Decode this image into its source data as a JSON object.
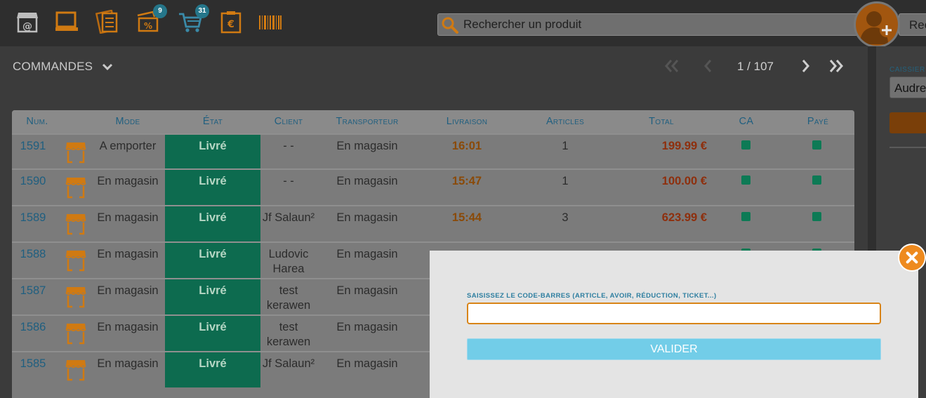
{
  "toolbar": {
    "icons": [
      {
        "name": "shop-email-icon",
        "badge": null
      },
      {
        "name": "laptop-icon",
        "badge": null
      },
      {
        "name": "calculator-icon",
        "badge": null
      },
      {
        "name": "discount-tag-icon",
        "badge": "9"
      },
      {
        "name": "cart-icon",
        "badge": "31"
      },
      {
        "name": "euro-clipboard-icon",
        "badge": null
      },
      {
        "name": "barcode-icon",
        "badge": null
      }
    ],
    "badge_discount": "9",
    "badge_cart": "31",
    "search_placeholder": "Rechercher un produit",
    "search2_text": "Rec"
  },
  "list": {
    "title": "COMMANDES",
    "page_indicator": "1 / 107"
  },
  "table": {
    "headers": {
      "num": "Num.",
      "mode": "Mode",
      "etat": "État",
      "client": "Client",
      "transporteur": "Transporteur",
      "livraison": "Livraison",
      "articles": "Articles",
      "total": "Total",
      "ca": "CA",
      "paye": "Payé"
    },
    "rows": [
      {
        "num": "1591",
        "mode": "A emporter",
        "etat": "Livré",
        "client": "- -",
        "transporteur": "En magasin",
        "livraison": "16:01",
        "articles": "1",
        "total": "199.99 €"
      },
      {
        "num": "1590",
        "mode": "En magasin",
        "etat": "Livré",
        "client": "- -",
        "transporteur": "En magasin",
        "livraison": "15:47",
        "articles": "1",
        "total": "100.00 €"
      },
      {
        "num": "1589",
        "mode": "En magasin",
        "etat": "Livré",
        "client": "Jf Salaun²",
        "transporteur": "En magasin",
        "livraison": "15:44",
        "articles": "3",
        "total": "623.99 €"
      },
      {
        "num": "1588",
        "mode": "En magasin",
        "etat": "Livré",
        "client": "Ludovic Harea",
        "transporteur": "En magasin",
        "livraison": "",
        "articles": "",
        "total": ""
      },
      {
        "num": "1587",
        "mode": "En magasin",
        "etat": "Livré",
        "client": "test kerawen",
        "transporteur": "En magasin",
        "livraison": "",
        "articles": "",
        "total": ""
      },
      {
        "num": "1586",
        "mode": "En magasin",
        "etat": "Livré",
        "client": "test kerawen",
        "transporteur": "En magasin",
        "livraison": "",
        "articles": "",
        "total": ""
      },
      {
        "num": "1585",
        "mode": "En magasin",
        "etat": "Livré",
        "client": "Jf Salaun²",
        "transporteur": "En magasin",
        "livraison": "",
        "articles": "",
        "total": ""
      }
    ]
  },
  "right_panel": {
    "caissier_label": "CAISSIER",
    "caissier_value": "Audrey"
  },
  "modal": {
    "label": "SAISISSEZ LE CODE-BARRES (ARTICLE, AVOIR, RÉDUCTION, TICKET...)",
    "input_value": "",
    "valider_label": "VALIDER"
  },
  "colors": {
    "accent_orange": "#d88418",
    "etat_green": "#0d6b4f",
    "header_blue": "#1f5f80",
    "valider_blue": "#72cde8"
  }
}
